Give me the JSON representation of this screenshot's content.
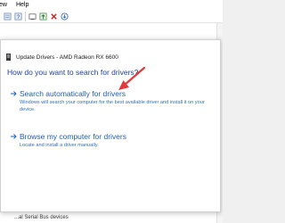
{
  "menubar": {
    "items": [
      "ew",
      "Help"
    ]
  },
  "toolbar": {
    "icons": [
      "properties-icon",
      "help-icon",
      "scan-icon",
      "update-driver-icon",
      "disable-icon",
      "uninstall-icon",
      "download-icon"
    ]
  },
  "background": {
    "bottom_text": "...al Serial Bus devices"
  },
  "dialog": {
    "title": "Update Drivers - AMD Radeon RX 6600",
    "heading": "How do you want to search for drivers?",
    "options": [
      {
        "title": "Search automatically for drivers",
        "description": "Windows will search your computer for the best available driver and install it on your device."
      },
      {
        "title": "Browse my computer for drivers",
        "description": "Locate and install a driver manually."
      }
    ]
  },
  "colors": {
    "heading": "#1f3e9c",
    "link": "#1f5fb0",
    "annotation_arrow": "#e03a3a"
  }
}
